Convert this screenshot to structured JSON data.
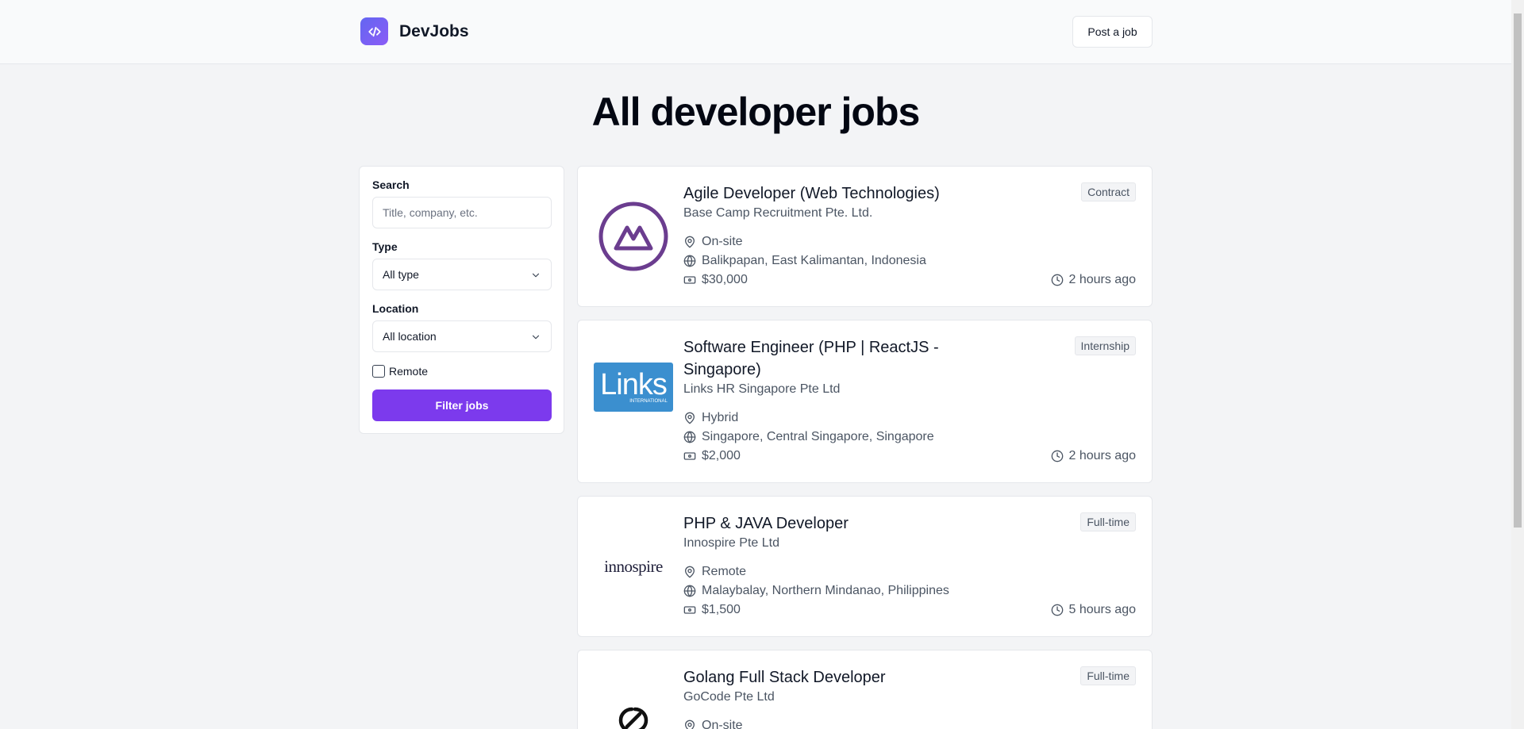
{
  "header": {
    "brand_name": "DevJobs",
    "post_job_label": "Post a job"
  },
  "page_title": "All developer jobs",
  "filters": {
    "search_label": "Search",
    "search_placeholder": "Title, company, etc.",
    "search_value": "",
    "type_label": "Type",
    "type_value": "All type",
    "location_label": "Location",
    "location_value": "All location",
    "remote_label": "Remote",
    "remote_checked": false,
    "filter_button": "Filter jobs"
  },
  "jobs": [
    {
      "title": "Agile Developer (Web Technologies)",
      "company": "Base Camp Recruitment Pte. Ltd.",
      "work_mode": "On-site",
      "location": "Balikpapan, East Kalimantan, Indonesia",
      "salary": "$30,000",
      "type": "Contract",
      "posted": "2 hours ago",
      "logo": "basecamp-logo"
    },
    {
      "title": "Software Engineer (PHP | ReactJS - Singapore)",
      "company": "Links HR Singapore Pte Ltd",
      "work_mode": "Hybrid",
      "location": "Singapore, Central Singapore, Singapore",
      "salary": "$2,000",
      "type": "Internship",
      "posted": "2 hours ago",
      "logo": "links-international-logo",
      "logo_text": "Links",
      "logo_subtext": "INTERNATIONAL"
    },
    {
      "title": "PHP & JAVA Developer",
      "company": "Innospire Pte Ltd",
      "work_mode": "Remote",
      "location": "Malaybalay, Northern Mindanao, Philippines",
      "salary": "$1,500",
      "type": "Full-time",
      "posted": "5 hours ago",
      "logo": "innospire-logo",
      "logo_text": "innospire"
    },
    {
      "title": "Golang Full Stack Developer",
      "company": "GoCode Pte Ltd",
      "work_mode": "On-site",
      "type": "Full-time",
      "logo": "gocode-logo"
    }
  ],
  "colors": {
    "accent": "#7c3aed",
    "background": "#f3f4f6",
    "basecamp_logo": "#6b3d8f",
    "links_logo": "#3b8fcf"
  },
  "icons": {
    "brand": "code-icon",
    "work_mode": "map-pin-icon",
    "location": "globe-icon",
    "salary": "banknote-icon",
    "posted": "clock-icon",
    "select": "chevron-down-icon"
  }
}
